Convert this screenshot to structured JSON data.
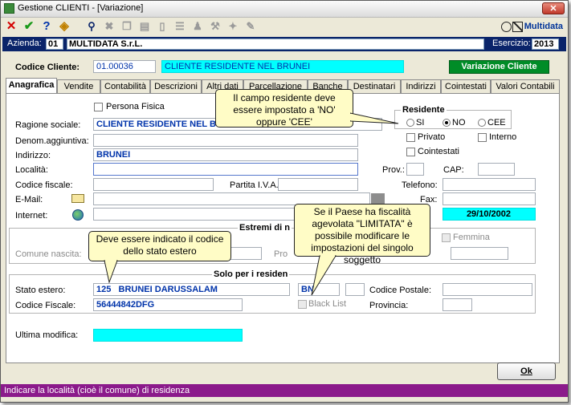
{
  "window": {
    "title": "Gestione CLIENTI - [Variazione]"
  },
  "toolbar": {
    "brand": "Multidata"
  },
  "azienda": {
    "label": "Azienda:",
    "code": "01",
    "name": "MULTIDATA S.r.L.",
    "esercizio_label": "Esercizio:",
    "esercizio": "2013"
  },
  "cliente": {
    "label": "Codice Cliente:",
    "code": "01.00036",
    "name": "CLIENTE RESIDENTE NEL BRUNEI",
    "mode_button": "Variazione Cliente"
  },
  "tabs": [
    "Anagrafica",
    "Vendite",
    "Contabilità",
    "Descrizioni",
    "Altri dati",
    "Parcellazione",
    "Banche",
    "Destinatari",
    "Indirizzi",
    "Cointestati",
    "Valori Contabili"
  ],
  "form": {
    "persona_fisica": "Persona Fisica",
    "ragione_sociale_label": "Ragione sociale:",
    "ragione_sociale": "CLIENTE RESIDENTE NEL B",
    "denom_label": "Denom.aggiuntiva:",
    "indirizzo_label": "Indirizzo:",
    "indirizzo": "BRUNEI",
    "localita_label": "Località:",
    "codice_fiscale_label": "Codice fiscale:",
    "partita_iva_label": "Partita I.V.A.:",
    "email_label": "E-Mail:",
    "internet_label": "Internet:",
    "residente_title": "Residente",
    "residente_options": [
      "SI",
      "NO",
      "CEE"
    ],
    "privato": "Privato",
    "interno": "Interno",
    "cointestati": "Cointestati",
    "prov_label": "Prov.:",
    "cap_label": "CAP:",
    "telefono_label": "Telefono:",
    "fax_label": "Fax:",
    "date_value": "29/10/2002",
    "estremi_title": "Estremi di n",
    "femmina": "Femmina",
    "comune_nascita_label": "Comune nascita:",
    "pro_label": "Pro",
    "solo_title": "Solo per i residen",
    "stato_estero_label": "Stato estero:",
    "stato_code": "125",
    "stato_name": "BRUNEI DARUSSALAM",
    "stato_sigla": "BN",
    "codice_postale_label": "Codice Postale:",
    "codice_fiscale2_label": "Codice Fiscale:",
    "codice_fiscale2": "56444842DFG",
    "black_list": "Black List",
    "provincia_label": "Provincia:",
    "ultima_modifica_label": "Ultima modifica:"
  },
  "callouts": {
    "residente": "Il campo residente deve essere impostato a 'NO' oppure 'CEE'",
    "stato": "Deve essere indicato il codice dello stato estero",
    "paese": "Se il Paese ha fiscalità agevolata \"LIMITATA\" è possibile modificare le impostazioni del singolo soggetto"
  },
  "ok_button": "Ok",
  "status": "Indicare la località (cioè il comune) di residenza",
  "colors": {
    "header_blue": "#0a246a",
    "accent_green": "#008c27",
    "highlight_cyan": "#00ffff",
    "status_purple": "#8b1a8b"
  }
}
